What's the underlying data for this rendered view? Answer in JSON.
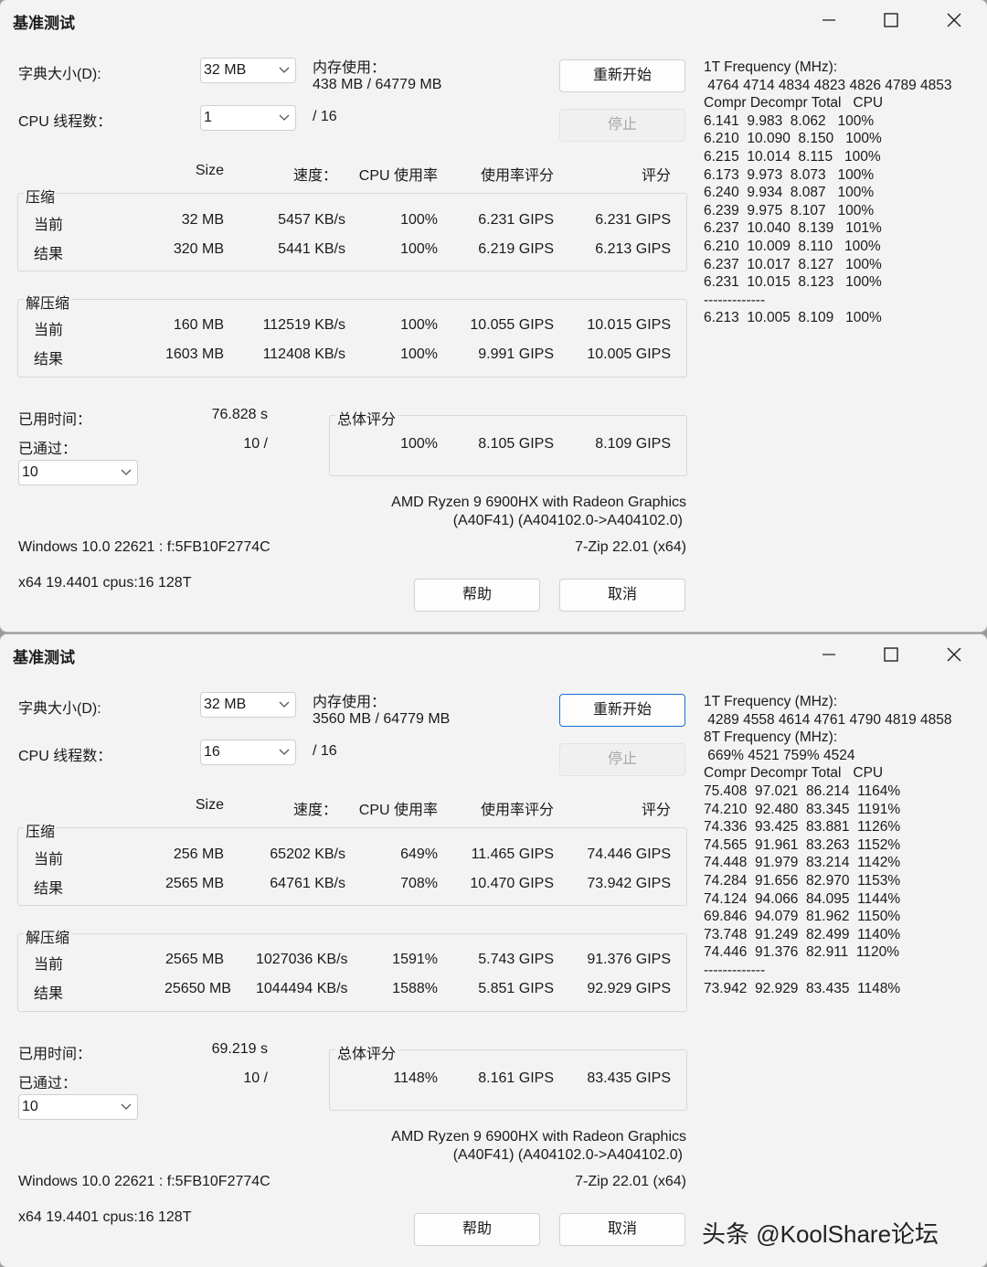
{
  "windows": [
    {
      "title": "基准测试",
      "dict_label": "字典大小(D):",
      "dict_value": "32 MB",
      "mem_label": "内存使用：",
      "mem_value": "438 MB / 64779 MB",
      "restart_label": "重新开始",
      "stop_label": "停止",
      "threads_label": "CPU 线程数：",
      "threads_value": "1",
      "threads_total": "/ 16",
      "col_size": "Size",
      "col_speed": "速度：",
      "col_cpu": "CPU 使用率",
      "col_rating_usage": "使用率评分",
      "col_rating": "评分",
      "compress_label": "压缩",
      "decompress_label": "解压缩",
      "current_label": "当前",
      "result_label": "结果",
      "compress_current": [
        "32 MB",
        "5457 KB/s",
        "100%",
        "6.231 GIPS",
        "6.231 GIPS"
      ],
      "compress_result": [
        "320 MB",
        "5441 KB/s",
        "100%",
        "6.219 GIPS",
        "6.213 GIPS"
      ],
      "decompress_current": [
        "160 MB",
        "112519 KB/s",
        "100%",
        "10.055 GIPS",
        "10.015 GIPS"
      ],
      "decompress_result": [
        "1603 MB",
        "112408 KB/s",
        "100%",
        "9.991 GIPS",
        "10.005 GIPS"
      ],
      "elapsed_label": "已用时间：",
      "elapsed_value": "76.828 s",
      "passed_label": "已通过：",
      "passed_value": "10 /",
      "passes_value": "10",
      "total_label": "总体评分",
      "total_row": [
        "100%",
        "8.105 GIPS",
        "8.109 GIPS"
      ],
      "cpu_line1": "AMD Ryzen 9 6900HX with Radeon Graphics",
      "cpu_line2": "(A40F41) (A404102.0->A404102.0)",
      "os_line": "Windows 10.0 22621 :  f:5FB10F2774C",
      "version_line": "7-Zip 22.01 (x64)",
      "arch_line": "x64 19.4401 cpus:16 128T",
      "help_label": "帮助",
      "cancel_label": "取消",
      "side_text": "1T Frequency (MHz):\n 4764 4714 4834 4823 4826 4789 4853\nCompr Decompr Total   CPU\n6.141  9.983  8.062   100%\n6.210  10.090  8.150   100%\n6.215  10.014  8.115   100%\n6.173  9.973  8.073   100%\n6.240  9.934  8.087   100%\n6.239  9.975  8.107   100%\n6.237  10.040  8.139   101%\n6.210  10.009  8.110   100%\n6.237  10.017  8.127   100%\n6.231  10.015  8.123   100%\n-------------\n6.213  10.005  8.109   100%"
    },
    {
      "title": "基准测试",
      "dict_label": "字典大小(D):",
      "dict_value": "32 MB",
      "mem_label": "内存使用：",
      "mem_value": "3560 MB / 64779 MB",
      "restart_label": "重新开始",
      "stop_label": "停止",
      "threads_label": "CPU 线程数：",
      "threads_value": "16",
      "threads_total": "/ 16",
      "col_size": "Size",
      "col_speed": "速度：",
      "col_cpu": "CPU 使用率",
      "col_rating_usage": "使用率评分",
      "col_rating": "评分",
      "compress_label": "压缩",
      "decompress_label": "解压缩",
      "current_label": "当前",
      "result_label": "结果",
      "compress_current": [
        "256 MB",
        "65202 KB/s",
        "649%",
        "11.465 GIPS",
        "74.446 GIPS"
      ],
      "compress_result": [
        "2565 MB",
        "64761 KB/s",
        "708%",
        "10.470 GIPS",
        "73.942 GIPS"
      ],
      "decompress_current": [
        "2565 MB",
        "1027036 KB/s",
        "1591%",
        "5.743 GIPS",
        "91.376 GIPS"
      ],
      "decompress_result": [
        "25650 MB",
        "1044494 KB/s",
        "1588%",
        "5.851 GIPS",
        "92.929 GIPS"
      ],
      "elapsed_label": "已用时间：",
      "elapsed_value": "69.219 s",
      "passed_label": "已通过：",
      "passed_value": "10 /",
      "passes_value": "10",
      "total_label": "总体评分",
      "total_row": [
        "1148%",
        "8.161 GIPS",
        "83.435 GIPS"
      ],
      "cpu_line1": "AMD Ryzen 9 6900HX with Radeon Graphics",
      "cpu_line2": "(A40F41) (A404102.0->A404102.0)",
      "os_line": "Windows 10.0 22621 :  f:5FB10F2774C",
      "version_line": "7-Zip 22.01 (x64)",
      "arch_line": "x64 19.4401 cpus:16 128T",
      "help_label": "帮助",
      "cancel_label": "取消",
      "side_text": "1T Frequency (MHz):\n 4289 4558 4614 4761 4790 4819 4858\n8T Frequency (MHz):\n 669% 4521 759% 4524\nCompr Decompr Total   CPU\n75.408  97.021  86.214  1164%\n74.210  92.480  83.345  1191%\n74.336  93.425  83.881  1126%\n74.565  91.961  83.263  1152%\n74.448  91.979  83.214  1142%\n74.284  91.656  82.970  1153%\n74.124  94.066  84.095  1144%\n69.846  94.079  81.962  1150%\n73.748  91.249  82.499  1140%\n74.446  91.376  82.911  1120%\n-------------\n73.942  92.929  83.435  1148%"
    }
  ],
  "watermark": "头条 @KoolShare论坛"
}
